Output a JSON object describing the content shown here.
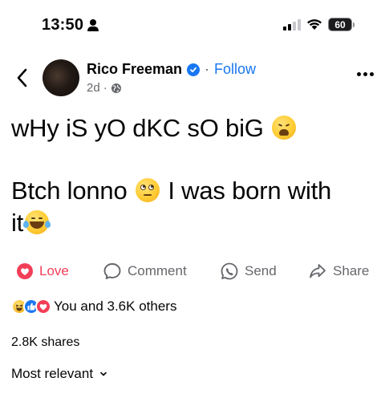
{
  "status_bar": {
    "time": "13:50",
    "battery": "60"
  },
  "post": {
    "author": "Rico Freeman",
    "follow_label": "Follow",
    "dot": "·",
    "age": "2d",
    "lines": [
      "wHy iS yO dKC sO biG",
      "Btch lonno",
      "I was born with",
      "it"
    ]
  },
  "actions": {
    "love": "Love",
    "comment": "Comment",
    "send": "Send",
    "share": "Share"
  },
  "reactions": {
    "summary": "You and 3.6K others"
  },
  "shares": "2.8K shares",
  "sort": {
    "label": "Most relevant"
  },
  "colors": {
    "accent": "#1877f2",
    "love": "#f33e58",
    "muted": "#65676b"
  },
  "icons": [
    "person-icon",
    "signal-icon",
    "wifi-icon",
    "battery-icon",
    "back-icon",
    "verified-icon",
    "globe-icon",
    "more-icon",
    "love-icon",
    "comment-icon",
    "send-icon",
    "share-icon",
    "chevron-down-icon"
  ]
}
